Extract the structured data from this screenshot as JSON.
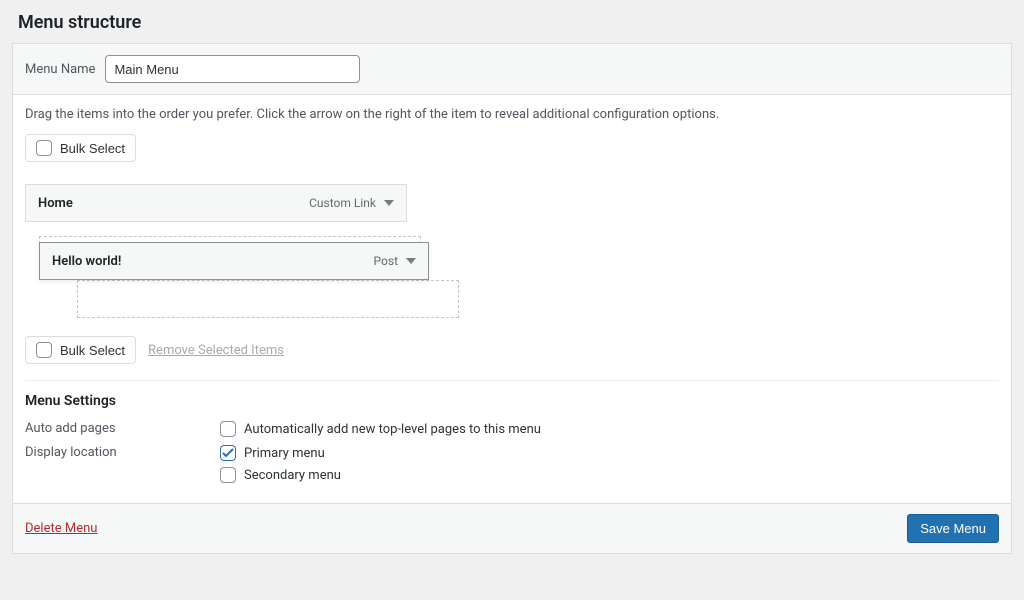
{
  "section_title": "Menu structure",
  "menu_name_label": "Menu Name",
  "menu_name_value": "Main Menu",
  "help_text": "Drag the items into the order you prefer. Click the arrow on the right of the item to reveal additional configuration options.",
  "bulk_select_label": "Bulk Select",
  "remove_selected_label": "Remove Selected Items",
  "menu_items": [
    {
      "title": "Home",
      "type": "Custom Link"
    },
    {
      "title": "Hello world!",
      "type": "Post"
    }
  ],
  "settings": {
    "heading": "Menu Settings",
    "auto_add_label": "Auto add pages",
    "auto_add_option": "Automatically add new top-level pages to this menu",
    "display_location_label": "Display location",
    "locations": [
      {
        "label": "Primary menu",
        "checked": true
      },
      {
        "label": "Secondary menu",
        "checked": false
      }
    ]
  },
  "footer": {
    "delete_label": "Delete Menu",
    "save_label": "Save Menu"
  }
}
